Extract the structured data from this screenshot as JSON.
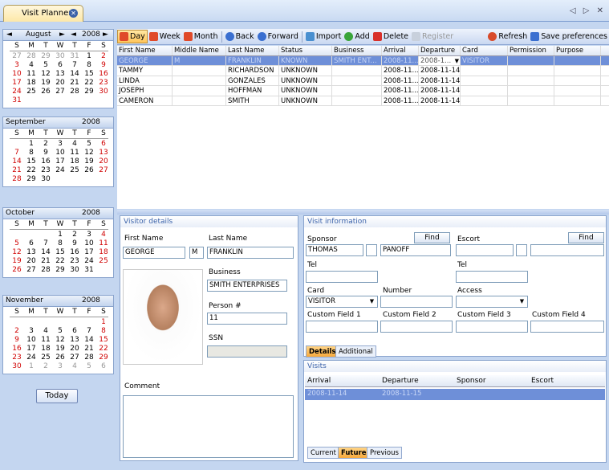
{
  "window": {
    "tab_title": "Visit Planner",
    "controls": "◁ ▷ ✕"
  },
  "calendar": {
    "months": [
      {
        "name": "August",
        "year": "2008",
        "rows": [
          [
            "27",
            "28",
            "29",
            "30",
            "31",
            "1",
            "2"
          ],
          [
            "3",
            "4",
            "5",
            "6",
            "7",
            "8",
            "9"
          ],
          [
            "10",
            "11",
            "12",
            "13",
            "14",
            "15",
            "16"
          ],
          [
            "17",
            "18",
            "19",
            "20",
            "21",
            "22",
            "23"
          ],
          [
            "24",
            "25",
            "26",
            "27",
            "28",
            "29",
            "30"
          ],
          [
            "31",
            "",
            "",
            "",
            "",
            "",
            ""
          ]
        ]
      },
      {
        "name": "September",
        "year": "2008",
        "rows": [
          [
            "",
            "1",
            "2",
            "3",
            "4",
            "5",
            "6"
          ],
          [
            "7",
            "8",
            "9",
            "10",
            "11",
            "12",
            "13"
          ],
          [
            "14",
            "15",
            "16",
            "17",
            "18",
            "19",
            "20"
          ],
          [
            "21",
            "22",
            "23",
            "24",
            "25",
            "26",
            "27"
          ],
          [
            "28",
            "29",
            "30",
            "",
            "",
            "",
            ""
          ]
        ]
      },
      {
        "name": "October",
        "year": "2008",
        "rows": [
          [
            "",
            "",
            "",
            "1",
            "2",
            "3",
            "4"
          ],
          [
            "5",
            "6",
            "7",
            "8",
            "9",
            "10",
            "11"
          ],
          [
            "12",
            "13",
            "14",
            "15",
            "16",
            "17",
            "18"
          ],
          [
            "19",
            "20",
            "21",
            "22",
            "23",
            "24",
            "25"
          ],
          [
            "26",
            "27",
            "28",
            "29",
            "30",
            "31",
            ""
          ]
        ]
      },
      {
        "name": "November",
        "year": "2008",
        "rows": [
          [
            "",
            "",
            "",
            "",
            "",
            "",
            "1"
          ],
          [
            "2",
            "3",
            "4",
            "5",
            "6",
            "7",
            "8"
          ],
          [
            "9",
            "10",
            "11",
            "12",
            "13",
            "14",
            "15"
          ],
          [
            "16",
            "17",
            "18",
            "19",
            "20",
            "21",
            "22"
          ],
          [
            "23",
            "24",
            "25",
            "26",
            "27",
            "28",
            "29"
          ],
          [
            "30",
            "1",
            "2",
            "3",
            "4",
            "5",
            "6"
          ]
        ]
      }
    ],
    "days": [
      "S",
      "M",
      "T",
      "W",
      "T",
      "F",
      "S"
    ],
    "today_label": "Today",
    "nav_prev": "◄",
    "nav_next": "►"
  },
  "toolbar": {
    "day": "Day",
    "week": "Week",
    "month": "Month",
    "back": "Back",
    "forward": "Forward",
    "import": "Import",
    "add": "Add",
    "delete": "Delete",
    "register": "Register",
    "refresh": "Refresh",
    "save": "Save preferences"
  },
  "table": {
    "columns": [
      "First Name",
      "Middle Name",
      "Last Name",
      "Status",
      "Business",
      "Arrival",
      "Departure",
      "Card",
      "Permission",
      "Purpose"
    ],
    "rows": [
      [
        "GEORGE",
        "M",
        "FRANKLIN",
        "KNOWN",
        "SMITH ENT...",
        "2008-11...",
        "2008-1...",
        "VISITOR",
        "",
        ""
      ],
      [
        "TAMMY",
        "",
        "RICHARDSON",
        "UNKNOWN",
        "",
        "2008-11...",
        "2008-11-14",
        "",
        "",
        ""
      ],
      [
        "LINDA",
        "",
        "GONZALES",
        "UNKNOWN",
        "",
        "2008-11...",
        "2008-11-14",
        "",
        "",
        ""
      ],
      [
        "JOSEPH",
        "",
        "HOFFMAN",
        "UNKNOWN",
        "",
        "2008-11...",
        "2008-11-14",
        "",
        "",
        ""
      ],
      [
        "CAMERON",
        "",
        "SMITH",
        "UNKNOWN",
        "",
        "2008-11...",
        "2008-11-14",
        "",
        "",
        ""
      ]
    ]
  },
  "visitor": {
    "title": "Visitor details",
    "first_label": "First Name",
    "last_label": "Last Name",
    "first": "GEORGE",
    "middle": "M",
    "last": "FRANKLIN",
    "business_label": "Business",
    "business": "SMITH ENTERPRISES",
    "person_label": "Person #",
    "person": "11",
    "ssn_label": "SSN",
    "ssn": "",
    "comment_label": "Comment"
  },
  "visit": {
    "title": "Visit information",
    "sponsor_label": "Sponsor",
    "escort_label": "Escort",
    "find": "Find",
    "sponsor_first": "THOMAS",
    "sponsor_last": "PANOFF",
    "tel_label": "Tel",
    "card_label": "Card",
    "card": "VISITOR",
    "number_label": "Number",
    "access_label": "Access",
    "cf1": "Custom Field 1",
    "cf2": "Custom Field 2",
    "cf3": "Custom Field 3",
    "cf4": "Custom Field 4",
    "tab_details": "Details",
    "tab_additional": "Additional"
  },
  "visits": {
    "title": "Visits",
    "columns": [
      "Arrival",
      "Departure",
      "Sponsor",
      "Escort"
    ],
    "row": [
      "2008-11-14",
      "2008-11-15",
      "",
      ""
    ],
    "tab_current": "Current",
    "tab_future": "Future",
    "tab_previous": "Previous"
  }
}
